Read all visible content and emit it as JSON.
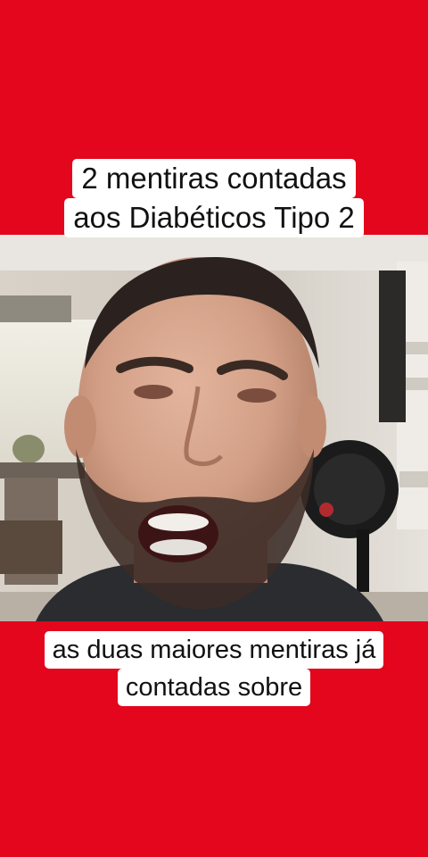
{
  "overlay": {
    "title_line_1": "2 mentiras contadas",
    "title_line_2": "aos Diabéticos Tipo 2"
  },
  "subtitle": {
    "line_1": "as duas maiores mentiras já",
    "line_2": "contadas sobre"
  },
  "colors": {
    "background": "#e3061c",
    "caption_box": "#ffffff",
    "caption_text": "#111111"
  }
}
